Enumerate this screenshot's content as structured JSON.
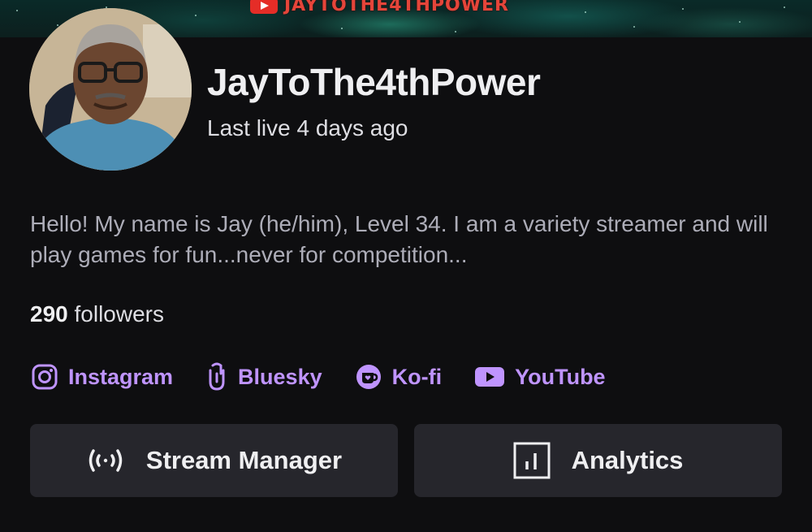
{
  "banner": {
    "text": "JAYTOTHE4THPOWER"
  },
  "profile": {
    "display_name": "JayToThe4thPower",
    "last_live": "Last live 4 days ago",
    "bio": "Hello! My name is Jay (he/him), Level 34. I am a variety streamer and will play games for fun...never for competition...",
    "followers_count": "290",
    "followers_label": "followers"
  },
  "socials": [
    {
      "label": "Instagram",
      "icon": "instagram-icon"
    },
    {
      "label": "Bluesky",
      "icon": "bluesky-link-icon"
    },
    {
      "label": "Ko-fi",
      "icon": "kofi-icon"
    },
    {
      "label": "YouTube",
      "icon": "youtube-icon"
    }
  ],
  "actions": {
    "stream_manager": "Stream Manager",
    "analytics": "Analytics"
  },
  "colors": {
    "background": "#0e0e10",
    "accent": "#bf94ff",
    "button": "#26262c",
    "banner_text": "#e5453a"
  }
}
